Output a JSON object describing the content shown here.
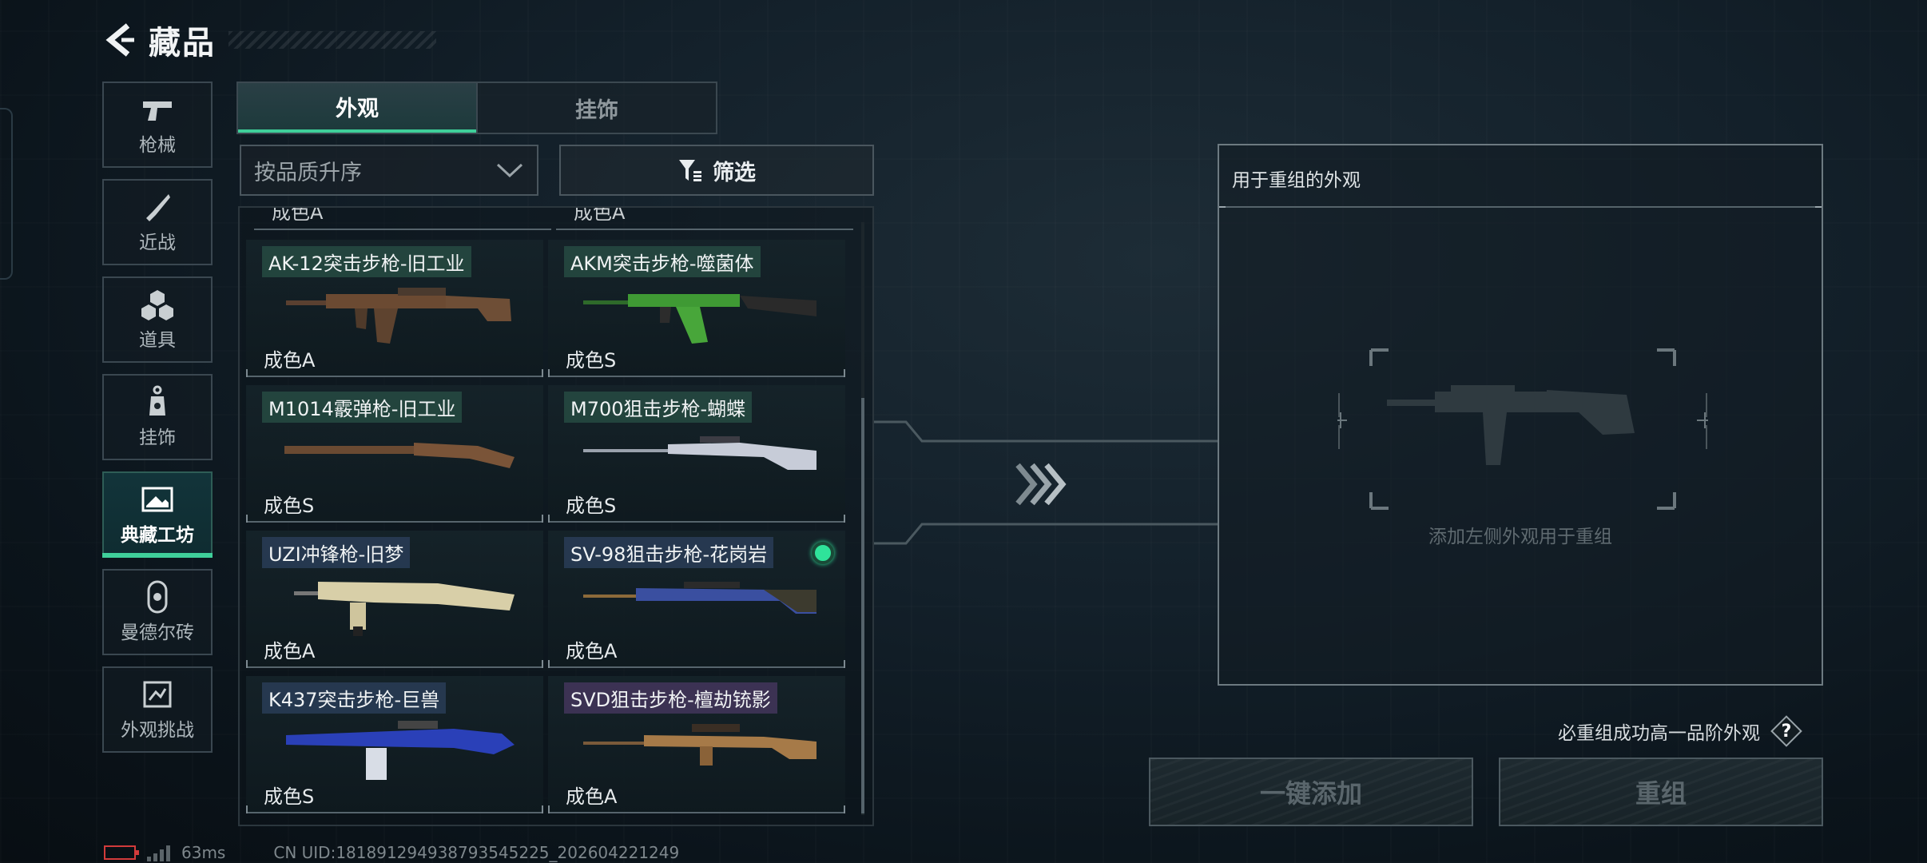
{
  "header": {
    "title": "藏品"
  },
  "sidebar": {
    "items": [
      {
        "label": "枪械",
        "icon": "pistol-icon"
      },
      {
        "label": "近战",
        "icon": "knife-icon"
      },
      {
        "label": "道具",
        "icon": "items-cube-icon"
      },
      {
        "label": "挂饰",
        "icon": "charm-icon"
      },
      {
        "label": "典藏工坊",
        "icon": "workshop-image-icon",
        "active": true
      },
      {
        "label": "曼德尔砖",
        "icon": "mandel-brick-icon"
      },
      {
        "label": "外观挑战",
        "icon": "challenge-icon"
      }
    ]
  },
  "tabs": [
    {
      "label": "外观",
      "active": true
    },
    {
      "label": "挂饰",
      "active": false
    }
  ],
  "sort": {
    "value": "按品质升序"
  },
  "filter": {
    "label": "筛选"
  },
  "prev_row_stub": {
    "text": "成色A"
  },
  "items": [
    {
      "name": "AK-12突击步枪-旧工业",
      "grade": "成色A",
      "tag_color": "green"
    },
    {
      "name": "AKM突击步枪-噬菌体",
      "grade": "成色S",
      "tag_color": "green"
    },
    {
      "name": "M1014霰弹枪-旧工业",
      "grade": "成色S",
      "tag_color": "green"
    },
    {
      "name": "M700狙击步枪-蝴蝶",
      "grade": "成色S",
      "tag_color": "green"
    },
    {
      "name": "UZI冲锋枪-旧梦",
      "grade": "成色A",
      "tag_color": "blue"
    },
    {
      "name": "SV-98狙击步枪-花岗岩",
      "grade": "成色A",
      "tag_color": "blue",
      "selected": true
    },
    {
      "name": "K437突击步枪-巨兽",
      "grade": "成色S",
      "tag_color": "blue"
    },
    {
      "name": "SVD狙击步枪-檀劫铳影",
      "grade": "成色A",
      "tag_color": "purple"
    }
  ],
  "reorg_panel": {
    "title": "用于重组的外观",
    "hint": "添加左侧外观用于重组"
  },
  "guarantee": {
    "text": "必重组成功高一品阶外观",
    "help": "?"
  },
  "buttons": {
    "add_all": "一键添加",
    "reorganize": "重组"
  },
  "status": {
    "ping": "63ms",
    "uid": "CN UID:181891294938793545225_202604221249"
  },
  "colors": {
    "accent": "#3fcf9a",
    "selected_dot": "#2fe39a",
    "battery_low": "#d23b3b"
  }
}
